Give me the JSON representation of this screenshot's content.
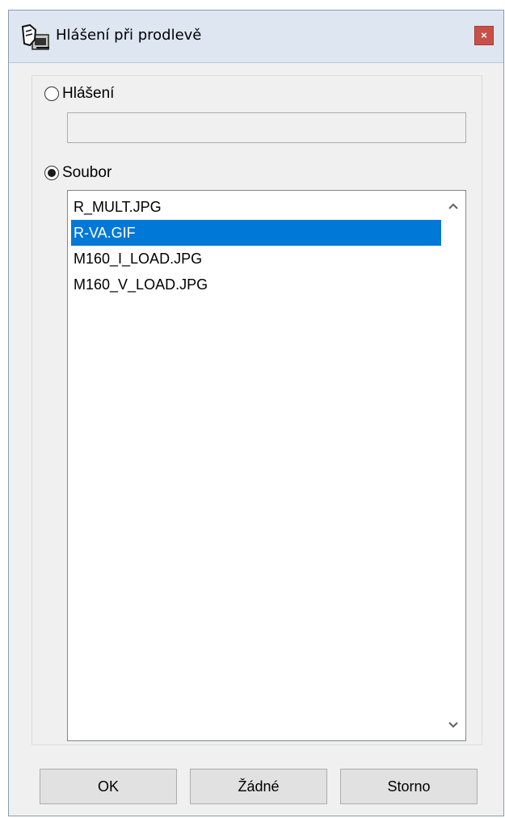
{
  "window": {
    "title": "Hlášení při prodlevě",
    "close_label": "×",
    "app_icon": "hand-notification-icon"
  },
  "options": {
    "message_label": "Hlášení",
    "message_selected": false,
    "message_value": "",
    "file_label": "Soubor",
    "file_selected": true
  },
  "file_list": {
    "items": [
      "R_MULT.JPG",
      "R-VA.GIF",
      "M160_I_LOAD.JPG",
      "M160_V_LOAD.JPG"
    ],
    "selected_index": 1,
    "scroll_up_icon": "chevron-up-icon",
    "scroll_down_icon": "chevron-down-icon"
  },
  "buttons": {
    "ok": "OK",
    "none": "Žádné",
    "cancel": "Storno"
  },
  "colors": {
    "selection": "#0078d7",
    "titlebar": "#dde6f1",
    "close": "#c7504a"
  }
}
